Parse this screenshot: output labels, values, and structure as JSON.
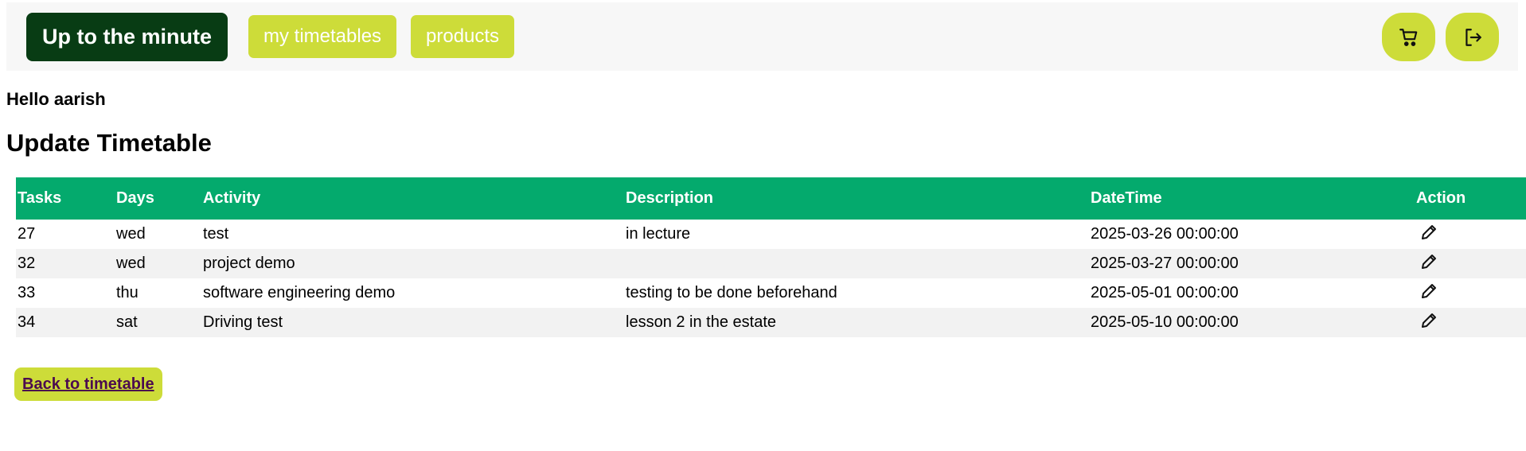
{
  "navbar": {
    "brand": "Up to the minute",
    "links": [
      "my timetables",
      "products"
    ],
    "cart_icon": "cart-icon",
    "logout_icon": "logout-icon",
    "accent_color": "#cddc39",
    "brand_color": "#083c14"
  },
  "greeting": "Hello aarish",
  "page_title": "Update Timetable",
  "table": {
    "header_color": "#04aa6d",
    "columns": [
      "Tasks",
      "Days",
      "Activity",
      "Description",
      "DateTime",
      "Action"
    ],
    "rows": [
      {
        "task": "27",
        "day": "wed",
        "activity": "test",
        "description": "in lecture",
        "datetime": "2025-03-26 00:00:00"
      },
      {
        "task": "32",
        "day": "wed",
        "activity": "project demo",
        "description": "",
        "datetime": "2025-03-27 00:00:00"
      },
      {
        "task": "33",
        "day": "thu",
        "activity": "software engineering demo",
        "description": "testing to be done beforehand",
        "datetime": "2025-05-01 00:00:00"
      },
      {
        "task": "34",
        "day": "sat",
        "activity": "Driving test",
        "description": "lesson 2 in the estate",
        "datetime": "2025-05-10 00:00:00"
      }
    ],
    "action_icon": "pencil-icon"
  },
  "back_link": "Back to timetable"
}
